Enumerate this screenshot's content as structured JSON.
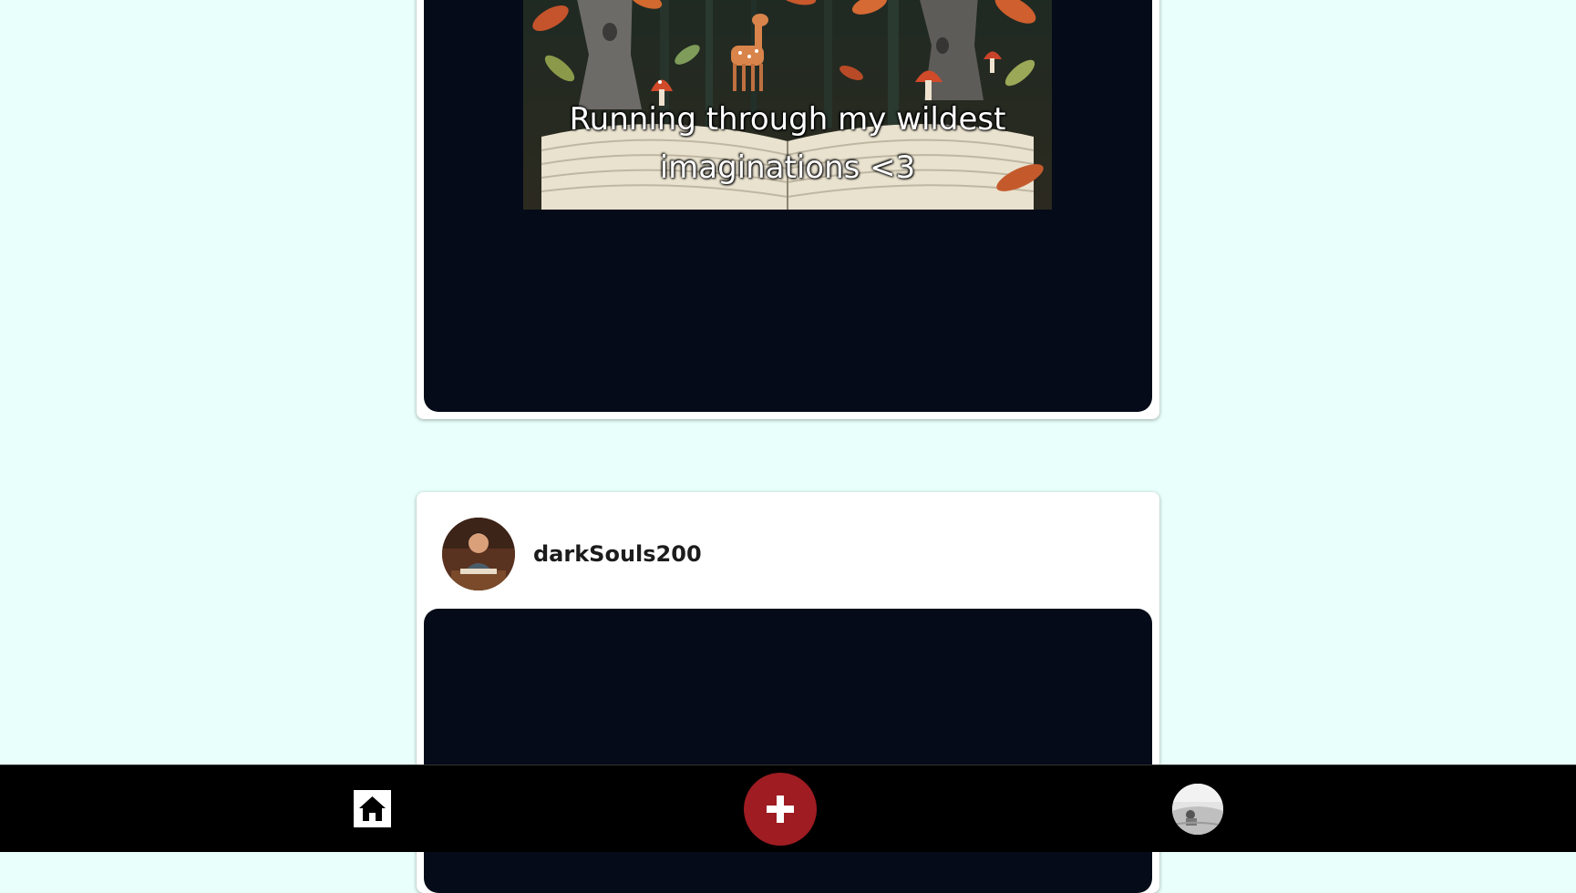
{
  "feed": {
    "posts": [
      {
        "caption": "Running through my wildest imaginations <3",
        "image": "forest-popup-book-illustration"
      },
      {
        "username": "darkSouls200",
        "avatar": "user-avatar-photo"
      }
    ]
  },
  "nav": {
    "home_icon": "home-icon",
    "add_icon": "plus-icon",
    "profile_icon": "profile-avatar",
    "colors": {
      "bar": "#000000",
      "add_button": "#9e1c22"
    }
  },
  "colors": {
    "page_background": "#e8fffb",
    "media_background": "#050b18"
  }
}
